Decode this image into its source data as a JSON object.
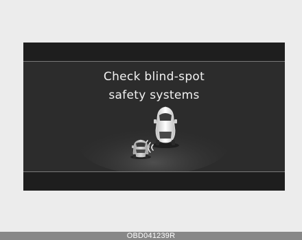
{
  "display": {
    "message_line1": "Check blind-spot",
    "message_line2": "safety systems"
  },
  "footer": {
    "code": "OBD041239R"
  },
  "icons": {
    "main_car": "car-rear-view-icon",
    "rear_car": "car-rear-view-icon",
    "sensor_waves": "radar-waves-icon"
  },
  "colors": {
    "screen_bg": "#2c2c2c",
    "strip_bg": "#1e1e1e",
    "text": "#f2f2f2",
    "page_bg": "#ececec",
    "footer_bg": "#878787"
  }
}
